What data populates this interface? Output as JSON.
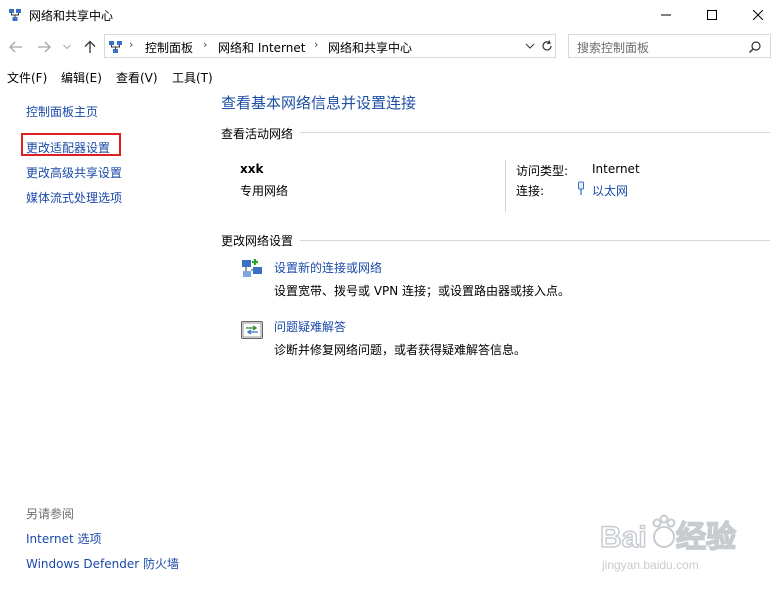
{
  "window": {
    "title": "网络和共享中心"
  },
  "address": {
    "breadcrumbs": [
      "控制面板",
      "网络和 Internet",
      "网络和共享中心"
    ],
    "search_placeholder": "搜索控制面板"
  },
  "menu": [
    "文件(F)",
    "编辑(E)",
    "查看(V)",
    "工具(T)"
  ],
  "sidebar": {
    "items": [
      "控制面板主页",
      "更改适配器设置",
      "更改高级共享设置",
      "媒体流式处理选项"
    ],
    "see_also_title": "另请参阅",
    "see_also": [
      "Internet 选项",
      "Windows Defender 防火墙"
    ]
  },
  "main": {
    "title": "查看基本网络信息并设置连接",
    "active_section": "查看活动网络",
    "network": {
      "name": "xxk",
      "type": "专用网络",
      "access_label": "访问类型:",
      "access_value": "Internet",
      "connection_label": "连接:",
      "connection_value": "以太网"
    },
    "change_section": "更改网络设置",
    "tasks": [
      {
        "link": "设置新的连接或网络",
        "desc": "设置宽带、拨号或 VPN 连接；或设置路由器或接入点。",
        "icon": "network-setup-icon"
      },
      {
        "link": "问题疑难解答",
        "desc": "诊断并修复网络问题，或者获得疑难解答信息。",
        "icon": "troubleshoot-icon"
      }
    ]
  },
  "watermark": {
    "text": "Bai du 经验",
    "url": "jingyan.baidu.com"
  },
  "colors": {
    "link": "#1a4aa8",
    "title": "#1e4fa5",
    "highlight": "#e02020"
  }
}
